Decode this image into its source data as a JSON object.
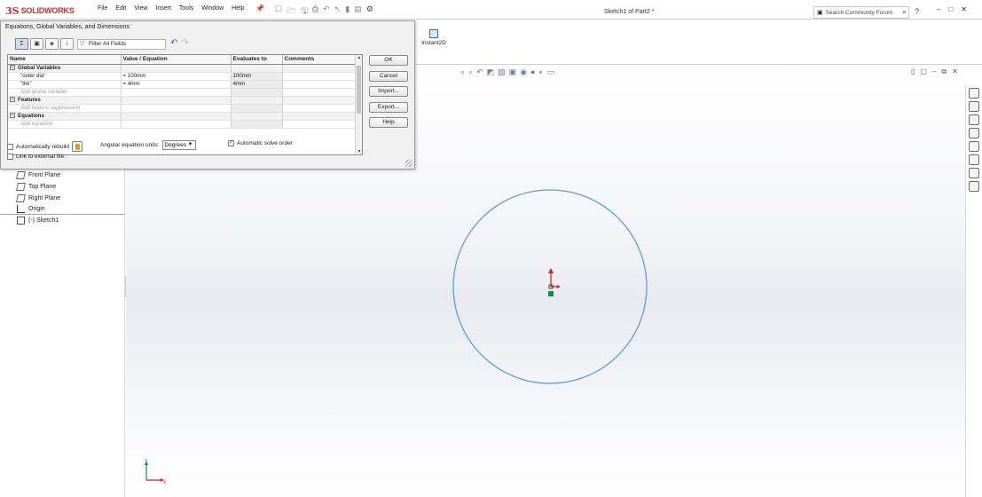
{
  "app": {
    "brand": "SOLIDWORKS",
    "brand_prefix": "3S",
    "document_title": "Sketch1 of Part2 *",
    "search_placeholder": "Search Community Forum",
    "help_label": "?",
    "menu": [
      "File",
      "Edit",
      "View",
      "Insert",
      "Tools",
      "Window",
      "Help"
    ]
  },
  "command_manager": {
    "instant2d_label": "Instant2D"
  },
  "feature_tree": {
    "items": [
      {
        "label": "Front Plane",
        "icon": "plane-icon"
      },
      {
        "label": "Top Plane",
        "icon": "plane-icon"
      },
      {
        "label": "Right Plane",
        "icon": "plane-icon"
      },
      {
        "label": "Origin",
        "icon": "origin-icon"
      },
      {
        "label": "(-) Sketch1",
        "icon": "sketch-icon"
      }
    ]
  },
  "dialog": {
    "title": "Equations, Global Variables, and Dimensions",
    "filter_placeholder": "Filter All Fields",
    "columns": [
      "Name",
      "Value / Equation",
      "Evaluates to",
      "Comments"
    ],
    "sections": {
      "global_variables": "Global Variables",
      "features": "Features",
      "equations": "Equations"
    },
    "rows": [
      {
        "name": "\"outer dia\"",
        "value": "= 100mm",
        "evaluates": "100mm",
        "comment": ""
      },
      {
        "name": "\"thk\"",
        "value": "= 4mm",
        "evaluates": "4mm",
        "comment": ""
      }
    ],
    "placeholders": {
      "global": "Add global variable",
      "feature": "Add feature suppression",
      "equation": "Add equation"
    },
    "buttons": {
      "ok": "OK",
      "cancel": "Cancel",
      "import": "Import...",
      "export": "Export...",
      "help": "Help"
    },
    "options": {
      "auto_rebuild": "Automatically rebuild",
      "auto_rebuild_checked": false,
      "angular_units_label": "Angular equation units:",
      "angular_units_value": "Degrees",
      "auto_solve": "Automatic solve order",
      "auto_solve_checked": true,
      "link_external": "Link to external file:",
      "link_external_checked": false
    }
  },
  "triad": {
    "x_label": "X",
    "y_label": "Y"
  },
  "colors": {
    "sketch_circle": "#5aa0e0",
    "origin_arrow": "#d62020",
    "origin_point": "#1a8a4a",
    "brand_red": "#d12a2a"
  }
}
